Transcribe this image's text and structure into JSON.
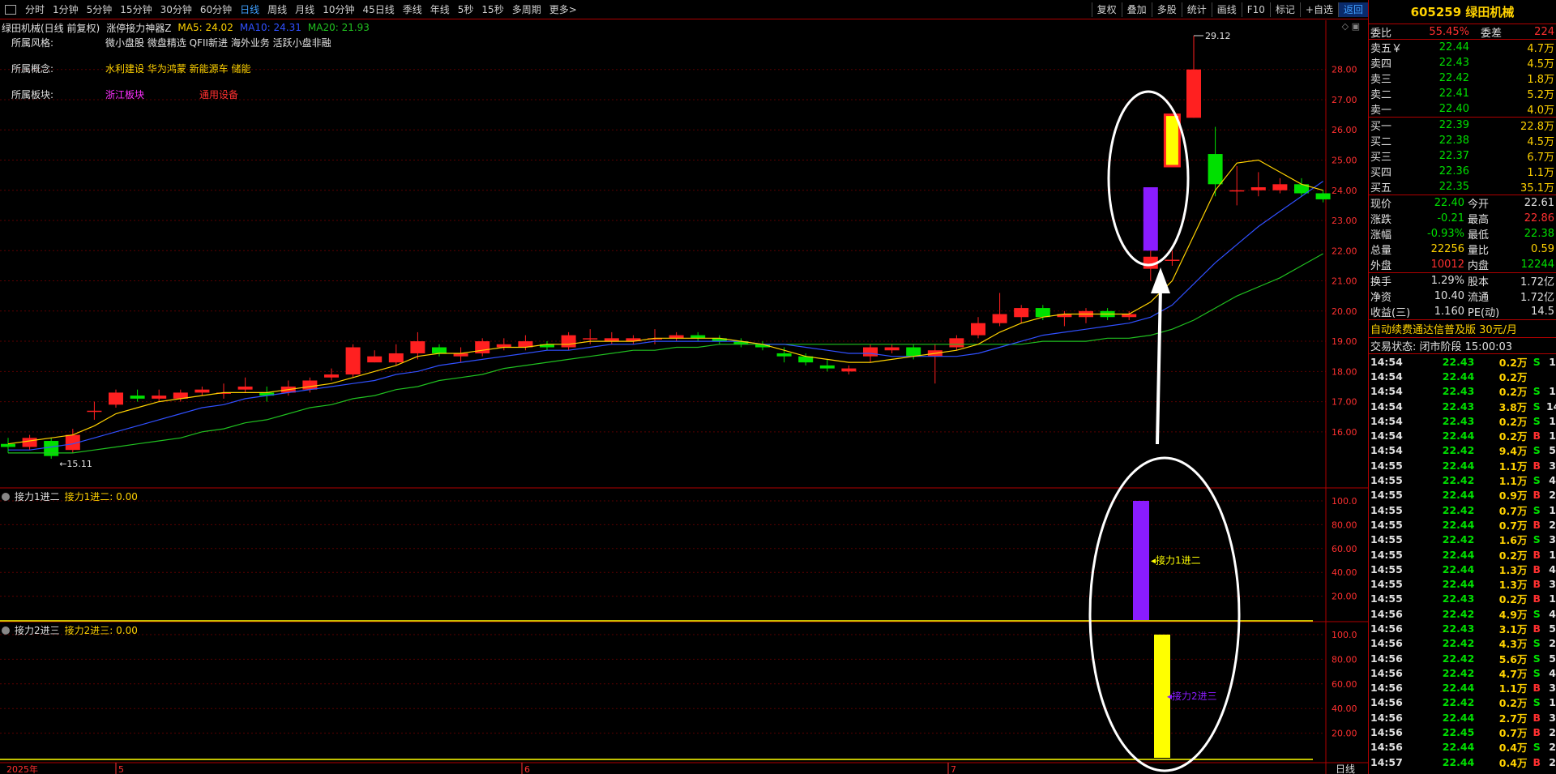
{
  "topbar": {
    "tabs": [
      "分时",
      "1分钟",
      "5分钟",
      "15分钟",
      "30分钟",
      "60分钟",
      "日线",
      "周线",
      "月线",
      "10分钟",
      "45日线",
      "季线",
      "年线",
      "5秒",
      "15秒",
      "多周期",
      "更多>"
    ],
    "active_tab": "日线",
    "right_buttons": [
      "复权",
      "叠加",
      "多股",
      "统计",
      "画线",
      "F10",
      "标记",
      "+自选",
      "返回"
    ]
  },
  "chart_header": {
    "stock_title": "绿田机械(日线 前复权)",
    "indicator": "涨停接力神器Z",
    "ma5": "MA5: 24.02",
    "ma10": "MA10: 24.31",
    "ma20": "MA20: 21.93"
  },
  "info": {
    "style_label": "所属风格:",
    "style_value": "微小盘股 微盘精选 QFII新进 海外业务 活跃小盘非融",
    "concept_label": "所属概念:",
    "concept_value": "水利建设 华为鸿蒙 新能源车 储能",
    "sector_label": "所属板块:",
    "sector_value1": "浙江板块",
    "sector_value2": "通用设备"
  },
  "price_axis": [
    "28.00",
    "27.00",
    "26.00",
    "25.00",
    "24.00",
    "23.00",
    "22.00",
    "21.00",
    "20.00",
    "19.00",
    "18.00",
    "17.00",
    "16.00"
  ],
  "max_label": "29.12",
  "min_label": "15.11",
  "sub1": {
    "title": "接力1进二",
    "label": "接力1进二: 0.00",
    "bar_label": "接力1进二",
    "axis": [
      "100.0",
      "80.00",
      "60.00",
      "40.00",
      "20.00"
    ]
  },
  "sub2": {
    "title": "接力2进三",
    "label": "接力2进三: 0.00",
    "bar_label": "接力2进三",
    "axis": [
      "100.0",
      "80.00",
      "60.00",
      "40.00",
      "20.00"
    ]
  },
  "date_axis": {
    "year": "2025年",
    "m5": "5",
    "m6": "6",
    "m7": "7",
    "right": "日线"
  },
  "colors": {
    "up": "#ff2020",
    "down": "#00e000",
    "ma5": "#ffd200",
    "ma10": "#3050ff",
    "ma20": "#20c020",
    "sig1": "#8a1cff",
    "sig2": "#ffff00"
  },
  "quote": {
    "title": "605259 绿田机械",
    "weibi_label": "委比",
    "weibi": "55.45%",
    "weicha_label": "委差",
    "weicha": "224",
    "asks": [
      {
        "label": "卖五￥",
        "price": "22.44",
        "vol": "4.7万"
      },
      {
        "label": "卖四",
        "price": "22.43",
        "vol": "4.5万"
      },
      {
        "label": "卖三",
        "price": "22.42",
        "vol": "1.8万"
      },
      {
        "label": "卖二",
        "price": "22.41",
        "vol": "5.2万"
      },
      {
        "label": "卖一",
        "price": "22.40",
        "vol": "4.0万"
      }
    ],
    "bids": [
      {
        "label": "买一",
        "price": "22.39",
        "vol": "22.8万"
      },
      {
        "label": "买二",
        "price": "22.38",
        "vol": "4.5万"
      },
      {
        "label": "买三",
        "price": "22.37",
        "vol": "6.7万"
      },
      {
        "label": "买四",
        "price": "22.36",
        "vol": "1.1万"
      },
      {
        "label": "买五",
        "price": "22.35",
        "vol": "35.1万"
      }
    ],
    "stats": [
      {
        "l1": "现价",
        "v1": "22.40",
        "l2": "今开",
        "v2": "22.61",
        "c1": "grn",
        "c2": "wht"
      },
      {
        "l1": "涨跌",
        "v1": "-0.21",
        "l2": "最高",
        "v2": "22.86",
        "c1": "grn",
        "c2": "red"
      },
      {
        "l1": "涨幅",
        "v1": "-0.93%",
        "l2": "最低",
        "v2": "22.38",
        "c1": "grn",
        "c2": "grn"
      },
      {
        "l1": "总量",
        "v1": "22256",
        "l2": "量比",
        "v2": "0.59",
        "c1": "yel",
        "c2": "yel"
      },
      {
        "l1": "外盘",
        "v1": "10012",
        "l2": "内盘",
        "v2": "12244",
        "c1": "red",
        "c2": "grn"
      }
    ],
    "stats2": [
      {
        "l1": "换手",
        "v1": "1.29%",
        "l2": "股本",
        "v2": "1.72亿"
      },
      {
        "l1": "净资",
        "v1": "10.40",
        "l2": "流通",
        "v2": "1.72亿"
      },
      {
        "l1": "收益(三)",
        "v1": "1.160",
        "l2": "PE(动)",
        "v2": "14.5"
      }
    ],
    "ad": "自动续费通达信普及版  30元/月",
    "state": "交易状态: 闭市阶段 15:00:03"
  },
  "ticks": [
    [
      "14:54",
      "22.43",
      "0.2万",
      "S",
      "1"
    ],
    [
      "14:54",
      "22.44",
      "0.2万",
      "",
      ""
    ],
    [
      "14:54",
      "22.43",
      "0.2万",
      "S",
      "1"
    ],
    [
      "14:54",
      "22.43",
      "3.8万",
      "S",
      "14"
    ],
    [
      "14:54",
      "22.43",
      "0.2万",
      "S",
      "1"
    ],
    [
      "14:54",
      "22.44",
      "0.2万",
      "B",
      "1"
    ],
    [
      "14:54",
      "22.42",
      "9.4万",
      "S",
      "5"
    ],
    [
      "14:55",
      "22.44",
      "1.1万",
      "B",
      "3"
    ],
    [
      "14:55",
      "22.42",
      "1.1万",
      "S",
      "4"
    ],
    [
      "14:55",
      "22.44",
      "0.9万",
      "B",
      "2"
    ],
    [
      "14:55",
      "22.42",
      "0.7万",
      "S",
      "1"
    ],
    [
      "14:55",
      "22.44",
      "0.7万",
      "B",
      "2"
    ],
    [
      "14:55",
      "22.42",
      "1.6万",
      "S",
      "3"
    ],
    [
      "14:55",
      "22.44",
      "0.2万",
      "B",
      "1"
    ],
    [
      "14:55",
      "22.44",
      "1.3万",
      "B",
      "4"
    ],
    [
      "14:55",
      "22.44",
      "1.3万",
      "B",
      "3"
    ],
    [
      "14:55",
      "22.43",
      "0.2万",
      "B",
      "1"
    ],
    [
      "14:56",
      "22.42",
      "4.9万",
      "S",
      "4"
    ],
    [
      "14:56",
      "22.43",
      "3.1万",
      "B",
      "5"
    ],
    [
      "14:56",
      "22.42",
      "4.3万",
      "S",
      "2"
    ],
    [
      "14:56",
      "22.42",
      "5.6万",
      "S",
      "5"
    ],
    [
      "14:56",
      "22.42",
      "4.7万",
      "S",
      "4"
    ],
    [
      "14:56",
      "22.44",
      "1.1万",
      "B",
      "3"
    ],
    [
      "14:56",
      "22.42",
      "0.2万",
      "S",
      "1"
    ],
    [
      "14:56",
      "22.44",
      "2.7万",
      "B",
      "3"
    ],
    [
      "14:56",
      "22.45",
      "0.7万",
      "B",
      "2"
    ],
    [
      "14:56",
      "22.44",
      "0.4万",
      "S",
      "2"
    ],
    [
      "14:57",
      "22.44",
      "0.4万",
      "B",
      "2"
    ]
  ],
  "candles": [
    {
      "o": 15.6,
      "c": 15.5,
      "h": 15.8,
      "l": 15.3
    },
    {
      "o": 15.5,
      "c": 15.8,
      "h": 15.9,
      "l": 15.4
    },
    {
      "o": 15.7,
      "c": 15.2,
      "h": 15.8,
      "l": 15.11
    },
    {
      "o": 15.4,
      "c": 15.9,
      "h": 16.1,
      "l": 15.3
    },
    {
      "o": 16.7,
      "c": 16.7,
      "h": 17.0,
      "l": 16.4
    },
    {
      "o": 16.9,
      "c": 17.3,
      "h": 17.4,
      "l": 16.8
    },
    {
      "o": 17.2,
      "c": 17.1,
      "h": 17.4,
      "l": 17.0
    },
    {
      "o": 17.1,
      "c": 17.2,
      "h": 17.4,
      "l": 17.0
    },
    {
      "o": 17.1,
      "c": 17.3,
      "h": 17.4,
      "l": 17.0
    },
    {
      "o": 17.3,
      "c": 17.4,
      "h": 17.5,
      "l": 17.2
    },
    {
      "o": 17.3,
      "c": 17.3,
      "h": 17.6,
      "l": 17.1
    },
    {
      "o": 17.4,
      "c": 17.5,
      "h": 17.8,
      "l": 17.3
    },
    {
      "o": 17.3,
      "c": 17.2,
      "h": 17.5,
      "l": 17.0
    },
    {
      "o": 17.3,
      "c": 17.5,
      "h": 17.7,
      "l": 17.2
    },
    {
      "o": 17.4,
      "c": 17.7,
      "h": 17.8,
      "l": 17.3
    },
    {
      "o": 17.8,
      "c": 17.9,
      "h": 18.1,
      "l": 17.7
    },
    {
      "o": 17.9,
      "c": 18.8,
      "h": 18.9,
      "l": 17.8
    },
    {
      "o": 18.3,
      "c": 18.5,
      "h": 18.7,
      "l": 18.3
    },
    {
      "o": 18.3,
      "c": 18.6,
      "h": 18.9,
      "l": 18.2
    },
    {
      "o": 18.6,
      "c": 19.0,
      "h": 19.3,
      "l": 18.4
    },
    {
      "o": 18.8,
      "c": 18.6,
      "h": 18.9,
      "l": 18.5
    },
    {
      "o": 18.5,
      "c": 18.6,
      "h": 18.8,
      "l": 18.3
    },
    {
      "o": 18.6,
      "c": 19.0,
      "h": 19.1,
      "l": 18.5
    },
    {
      "o": 18.8,
      "c": 18.9,
      "h": 19.1,
      "l": 18.7
    },
    {
      "o": 18.8,
      "c": 19.0,
      "h": 19.2,
      "l": 18.7
    },
    {
      "o": 18.9,
      "c": 18.8,
      "h": 19.0,
      "l": 18.7
    },
    {
      "o": 18.8,
      "c": 19.2,
      "h": 19.3,
      "l": 18.7
    },
    {
      "o": 19.1,
      "c": 19.1,
      "h": 19.4,
      "l": 18.9
    },
    {
      "o": 19.0,
      "c": 19.1,
      "h": 19.3,
      "l": 18.9
    },
    {
      "o": 19.0,
      "c": 19.1,
      "h": 19.2,
      "l": 18.9
    },
    {
      "o": 19.1,
      "c": 19.1,
      "h": 19.4,
      "l": 18.9
    },
    {
      "o": 19.1,
      "c": 19.2,
      "h": 19.3,
      "l": 19.0
    },
    {
      "o": 19.2,
      "c": 19.1,
      "h": 19.3,
      "l": 19.0
    },
    {
      "o": 19.1,
      "c": 19.0,
      "h": 19.2,
      "l": 18.9
    },
    {
      "o": 19.0,
      "c": 18.9,
      "h": 19.1,
      "l": 18.8
    },
    {
      "o": 18.9,
      "c": 18.8,
      "h": 19.0,
      "l": 18.7
    },
    {
      "o": 18.6,
      "c": 18.5,
      "h": 18.8,
      "l": 18.3
    },
    {
      "o": 18.5,
      "c": 18.3,
      "h": 18.6,
      "l": 18.2
    },
    {
      "o": 18.2,
      "c": 18.1,
      "h": 18.4,
      "l": 18.0
    },
    {
      "o": 18.0,
      "c": 18.1,
      "h": 18.2,
      "l": 17.9
    },
    {
      "o": 18.5,
      "c": 18.8,
      "h": 18.9,
      "l": 18.3
    },
    {
      "o": 18.7,
      "c": 18.8,
      "h": 18.9,
      "l": 18.6
    },
    {
      "o": 18.8,
      "c": 18.5,
      "h": 18.9,
      "l": 18.4
    },
    {
      "o": 18.5,
      "c": 18.7,
      "h": 18.9,
      "l": 17.6
    },
    {
      "o": 18.8,
      "c": 19.1,
      "h": 19.2,
      "l": 18.7
    },
    {
      "o": 19.2,
      "c": 19.6,
      "h": 19.8,
      "l": 19.1
    },
    {
      "o": 19.6,
      "c": 19.9,
      "h": 20.6,
      "l": 19.5
    },
    {
      "o": 19.8,
      "c": 20.1,
      "h": 20.2,
      "l": 19.6
    },
    {
      "o": 20.1,
      "c": 19.8,
      "h": 20.2,
      "l": 19.7
    },
    {
      "o": 19.8,
      "c": 19.9,
      "h": 20.0,
      "l": 19.5
    },
    {
      "o": 19.8,
      "c": 20.0,
      "h": 20.1,
      "l": 19.6
    },
    {
      "o": 20.0,
      "c": 19.8,
      "h": 20.1,
      "l": 19.7
    },
    {
      "o": 19.8,
      "c": 19.9,
      "h": 20.0,
      "l": 19.7
    },
    {
      "o": 21.4,
      "c": 21.8,
      "h": 22.0,
      "l": 21.0
    },
    {
      "o": 21.7,
      "c": 21.7,
      "h": 22.0,
      "l": 21.5
    },
    {
      "o": 26.4,
      "c": 28.0,
      "h": 29.12,
      "l": 26.4
    },
    {
      "o": 25.2,
      "c": 24.2,
      "h": 26.1,
      "l": 23.8
    },
    {
      "o": 24.0,
      "c": 24.0,
      "h": 24.8,
      "l": 23.5
    },
    {
      "o": 24.0,
      "c": 24.1,
      "h": 24.6,
      "l": 23.8
    },
    {
      "o": 24.0,
      "c": 24.2,
      "h": 24.4,
      "l": 23.9
    },
    {
      "o": 24.2,
      "c": 23.9,
      "h": 24.4,
      "l": 23.8
    },
    {
      "o": 23.9,
      "c": 23.7,
      "h": 24.0,
      "l": 23.6
    }
  ],
  "ma5_path": [
    15.6,
    15.7,
    15.8,
    15.9,
    16.2,
    16.6,
    16.8,
    17.0,
    17.1,
    17.2,
    17.3,
    17.3,
    17.3,
    17.4,
    17.5,
    17.6,
    17.8,
    18.0,
    18.2,
    18.5,
    18.6,
    18.6,
    18.7,
    18.8,
    18.8,
    18.9,
    18.9,
    19.0,
    19.0,
    19.0,
    19.1,
    19.1,
    19.1,
    19.1,
    19.0,
    18.9,
    18.7,
    18.5,
    18.4,
    18.3,
    18.3,
    18.4,
    18.5,
    18.6,
    18.7,
    18.9,
    19.3,
    19.6,
    19.8,
    19.9,
    19.9,
    19.9,
    19.9,
    20.3,
    21.0,
    22.5,
    24.0,
    24.9,
    25.0,
    24.6,
    24.2,
    24.0
  ],
  "ma10_path": [
    15.4,
    15.4,
    15.5,
    15.6,
    15.8,
    16.0,
    16.2,
    16.4,
    16.6,
    16.8,
    16.9,
    17.1,
    17.2,
    17.3,
    17.4,
    17.5,
    17.6,
    17.7,
    17.9,
    18.0,
    18.2,
    18.3,
    18.4,
    18.5,
    18.6,
    18.7,
    18.7,
    18.8,
    18.9,
    18.9,
    19.0,
    19.0,
    19.0,
    19.0,
    19.0,
    18.9,
    18.9,
    18.8,
    18.7,
    18.6,
    18.6,
    18.5,
    18.5,
    18.5,
    18.5,
    18.6,
    18.8,
    19.0,
    19.2,
    19.3,
    19.4,
    19.5,
    19.6,
    19.8,
    20.2,
    20.9,
    21.6,
    22.2,
    22.8,
    23.3,
    23.8,
    24.3
  ],
  "ma20_path": [
    15.3,
    15.3,
    15.3,
    15.3,
    15.4,
    15.5,
    15.6,
    15.7,
    15.8,
    16.0,
    16.1,
    16.3,
    16.4,
    16.6,
    16.8,
    16.9,
    17.1,
    17.2,
    17.4,
    17.5,
    17.7,
    17.8,
    17.9,
    18.1,
    18.2,
    18.3,
    18.4,
    18.5,
    18.6,
    18.7,
    18.7,
    18.8,
    18.8,
    18.9,
    18.9,
    18.9,
    18.9,
    18.9,
    18.9,
    18.9,
    18.9,
    18.9,
    18.9,
    18.9,
    18.9,
    18.9,
    18.9,
    18.9,
    19.0,
    19.0,
    19.0,
    19.1,
    19.1,
    19.2,
    19.4,
    19.7,
    20.1,
    20.5,
    20.8,
    21.1,
    21.5,
    21.9
  ]
}
